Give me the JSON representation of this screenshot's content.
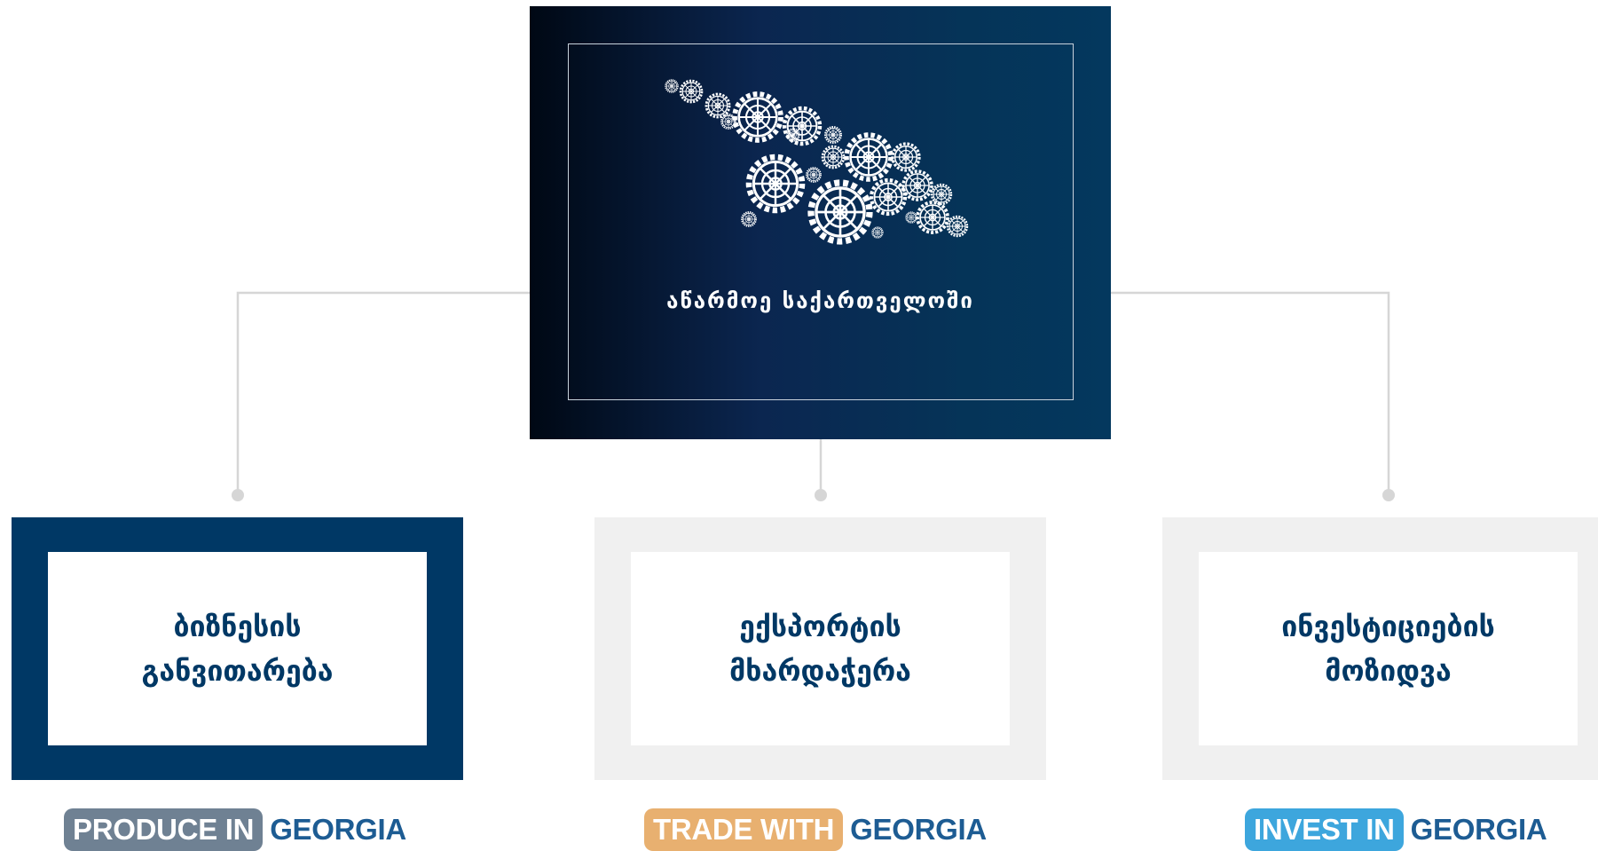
{
  "hero": {
    "title": "აწარმოე საქართველოში",
    "icon": "georgia-gears-map-icon"
  },
  "cards": [
    {
      "line1": "ბიზნესის",
      "line2": "განვითარება",
      "state": "active"
    },
    {
      "line1": "ექსპორტის",
      "line2": "მხარდაჭერა",
      "state": "inactive"
    },
    {
      "line1": "ინვესტიციების",
      "line2": "მოზიდვა",
      "state": "inactive"
    }
  ],
  "brands": [
    {
      "tag": "PRODUCE IN",
      "word": "GEORGIA",
      "color": "#6f8193"
    },
    {
      "tag": "TRADE WITH",
      "word": "GEORGIA",
      "color": "#e8b070"
    },
    {
      "tag": "INVEST IN",
      "word": "GEORGIA",
      "color": "#3da6dd"
    }
  ],
  "colors": {
    "brand_dark": "#003865",
    "connector": "#d6d6d6",
    "card_inactive": "#f0f0f0"
  }
}
